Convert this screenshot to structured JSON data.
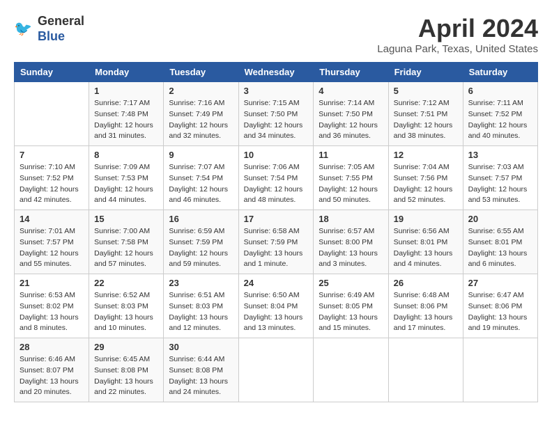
{
  "header": {
    "logo_line1": "General",
    "logo_line2": "Blue",
    "month": "April 2024",
    "location": "Laguna Park, Texas, United States"
  },
  "days_of_week": [
    "Sunday",
    "Monday",
    "Tuesday",
    "Wednesday",
    "Thursday",
    "Friday",
    "Saturday"
  ],
  "weeks": [
    [
      {
        "day": "",
        "info": ""
      },
      {
        "day": "1",
        "info": "Sunrise: 7:17 AM\nSunset: 7:48 PM\nDaylight: 12 hours\nand 31 minutes."
      },
      {
        "day": "2",
        "info": "Sunrise: 7:16 AM\nSunset: 7:49 PM\nDaylight: 12 hours\nand 32 minutes."
      },
      {
        "day": "3",
        "info": "Sunrise: 7:15 AM\nSunset: 7:50 PM\nDaylight: 12 hours\nand 34 minutes."
      },
      {
        "day": "4",
        "info": "Sunrise: 7:14 AM\nSunset: 7:50 PM\nDaylight: 12 hours\nand 36 minutes."
      },
      {
        "day": "5",
        "info": "Sunrise: 7:12 AM\nSunset: 7:51 PM\nDaylight: 12 hours\nand 38 minutes."
      },
      {
        "day": "6",
        "info": "Sunrise: 7:11 AM\nSunset: 7:52 PM\nDaylight: 12 hours\nand 40 minutes."
      }
    ],
    [
      {
        "day": "7",
        "info": "Sunrise: 7:10 AM\nSunset: 7:52 PM\nDaylight: 12 hours\nand 42 minutes."
      },
      {
        "day": "8",
        "info": "Sunrise: 7:09 AM\nSunset: 7:53 PM\nDaylight: 12 hours\nand 44 minutes."
      },
      {
        "day": "9",
        "info": "Sunrise: 7:07 AM\nSunset: 7:54 PM\nDaylight: 12 hours\nand 46 minutes."
      },
      {
        "day": "10",
        "info": "Sunrise: 7:06 AM\nSunset: 7:54 PM\nDaylight: 12 hours\nand 48 minutes."
      },
      {
        "day": "11",
        "info": "Sunrise: 7:05 AM\nSunset: 7:55 PM\nDaylight: 12 hours\nand 50 minutes."
      },
      {
        "day": "12",
        "info": "Sunrise: 7:04 AM\nSunset: 7:56 PM\nDaylight: 12 hours\nand 52 minutes."
      },
      {
        "day": "13",
        "info": "Sunrise: 7:03 AM\nSunset: 7:57 PM\nDaylight: 12 hours\nand 53 minutes."
      }
    ],
    [
      {
        "day": "14",
        "info": "Sunrise: 7:01 AM\nSunset: 7:57 PM\nDaylight: 12 hours\nand 55 minutes."
      },
      {
        "day": "15",
        "info": "Sunrise: 7:00 AM\nSunset: 7:58 PM\nDaylight: 12 hours\nand 57 minutes."
      },
      {
        "day": "16",
        "info": "Sunrise: 6:59 AM\nSunset: 7:59 PM\nDaylight: 12 hours\nand 59 minutes."
      },
      {
        "day": "17",
        "info": "Sunrise: 6:58 AM\nSunset: 7:59 PM\nDaylight: 13 hours\nand 1 minute."
      },
      {
        "day": "18",
        "info": "Sunrise: 6:57 AM\nSunset: 8:00 PM\nDaylight: 13 hours\nand 3 minutes."
      },
      {
        "day": "19",
        "info": "Sunrise: 6:56 AM\nSunset: 8:01 PM\nDaylight: 13 hours\nand 4 minutes."
      },
      {
        "day": "20",
        "info": "Sunrise: 6:55 AM\nSunset: 8:01 PM\nDaylight: 13 hours\nand 6 minutes."
      }
    ],
    [
      {
        "day": "21",
        "info": "Sunrise: 6:53 AM\nSunset: 8:02 PM\nDaylight: 13 hours\nand 8 minutes."
      },
      {
        "day": "22",
        "info": "Sunrise: 6:52 AM\nSunset: 8:03 PM\nDaylight: 13 hours\nand 10 minutes."
      },
      {
        "day": "23",
        "info": "Sunrise: 6:51 AM\nSunset: 8:03 PM\nDaylight: 13 hours\nand 12 minutes."
      },
      {
        "day": "24",
        "info": "Sunrise: 6:50 AM\nSunset: 8:04 PM\nDaylight: 13 hours\nand 13 minutes."
      },
      {
        "day": "25",
        "info": "Sunrise: 6:49 AM\nSunset: 8:05 PM\nDaylight: 13 hours\nand 15 minutes."
      },
      {
        "day": "26",
        "info": "Sunrise: 6:48 AM\nSunset: 8:06 PM\nDaylight: 13 hours\nand 17 minutes."
      },
      {
        "day": "27",
        "info": "Sunrise: 6:47 AM\nSunset: 8:06 PM\nDaylight: 13 hours\nand 19 minutes."
      }
    ],
    [
      {
        "day": "28",
        "info": "Sunrise: 6:46 AM\nSunset: 8:07 PM\nDaylight: 13 hours\nand 20 minutes."
      },
      {
        "day": "29",
        "info": "Sunrise: 6:45 AM\nSunset: 8:08 PM\nDaylight: 13 hours\nand 22 minutes."
      },
      {
        "day": "30",
        "info": "Sunrise: 6:44 AM\nSunset: 8:08 PM\nDaylight: 13 hours\nand 24 minutes."
      },
      {
        "day": "",
        "info": ""
      },
      {
        "day": "",
        "info": ""
      },
      {
        "day": "",
        "info": ""
      },
      {
        "day": "",
        "info": ""
      }
    ]
  ]
}
